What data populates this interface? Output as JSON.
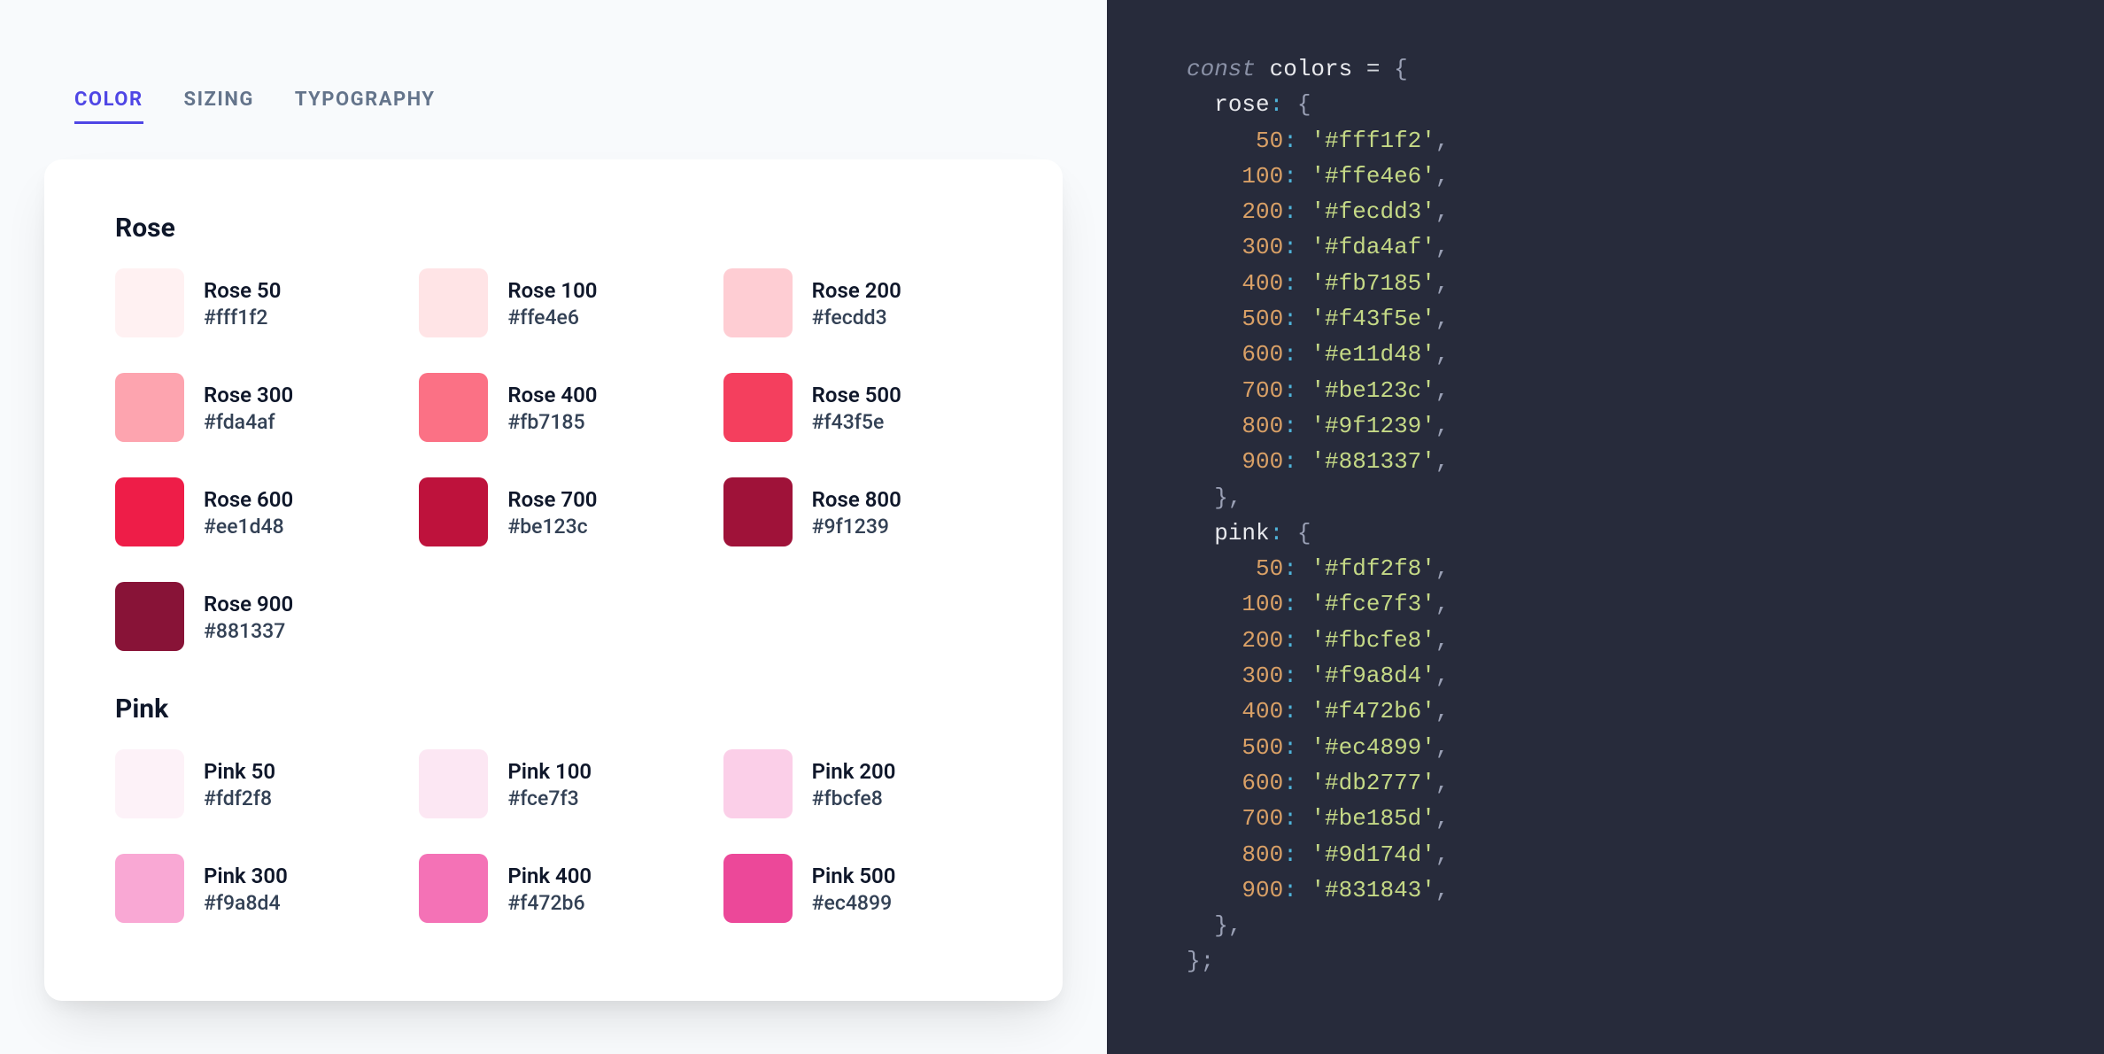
{
  "tabs": [
    {
      "label": "COLOR",
      "active": true
    },
    {
      "label": "SIZING",
      "active": false
    },
    {
      "label": "TYPOGRAPHY",
      "active": false
    }
  ],
  "palette": {
    "rose": {
      "label": "Rose",
      "shades": [
        {
          "step": 50,
          "label": "Rose 50",
          "hex": "#fff1f2"
        },
        {
          "step": 100,
          "label": "Rose 100",
          "hex": "#ffe4e6"
        },
        {
          "step": 200,
          "label": "Rose 200",
          "hex": "#fecdd3"
        },
        {
          "step": 300,
          "label": "Rose 300",
          "hex": "#fda4af"
        },
        {
          "step": 400,
          "label": "Rose 400",
          "hex": "#fb7185"
        },
        {
          "step": 500,
          "label": "Rose 500",
          "hex": "#f43f5e"
        },
        {
          "step": 600,
          "label": "Rose 600",
          "hex": "#ee1d48"
        },
        {
          "step": 700,
          "label": "Rose 700",
          "hex": "#be123c"
        },
        {
          "step": 800,
          "label": "Rose 800",
          "hex": "#9f1239"
        },
        {
          "step": 900,
          "label": "Rose 900",
          "hex": "#881337"
        }
      ]
    },
    "pink": {
      "label": "Pink",
      "shades": [
        {
          "step": 50,
          "label": "Pink 50",
          "hex": "#fdf2f8"
        },
        {
          "step": 100,
          "label": "Pink 100",
          "hex": "#fce7f3"
        },
        {
          "step": 200,
          "label": "Pink 200",
          "hex": "#fbcfe8"
        },
        {
          "step": 300,
          "label": "Pink 300",
          "hex": "#f9a8d4"
        },
        {
          "step": 400,
          "label": "Pink 400",
          "hex": "#f472b6"
        },
        {
          "step": 500,
          "label": "Pink 500",
          "hex": "#ec4899"
        }
      ]
    }
  },
  "code": {
    "var_keyword": "const",
    "var_name": "colors",
    "rose_code_hexes": {
      "50": "#fff1f2",
      "100": "#ffe4e6",
      "200": "#fecdd3",
      "300": "#fda4af",
      "400": "#fb7185",
      "500": "#f43f5e",
      "600": "#e11d48",
      "700": "#be123c",
      "800": "#9f1239",
      "900": "#881337"
    },
    "pink_code_hexes": {
      "50": "#fdf2f8",
      "100": "#fce7f3",
      "200": "#fbcfe8",
      "300": "#f9a8d4",
      "400": "#f472b6",
      "500": "#ec4899",
      "600": "#db2777",
      "700": "#be185d",
      "800": "#9d174d",
      "900": "#831843"
    }
  }
}
